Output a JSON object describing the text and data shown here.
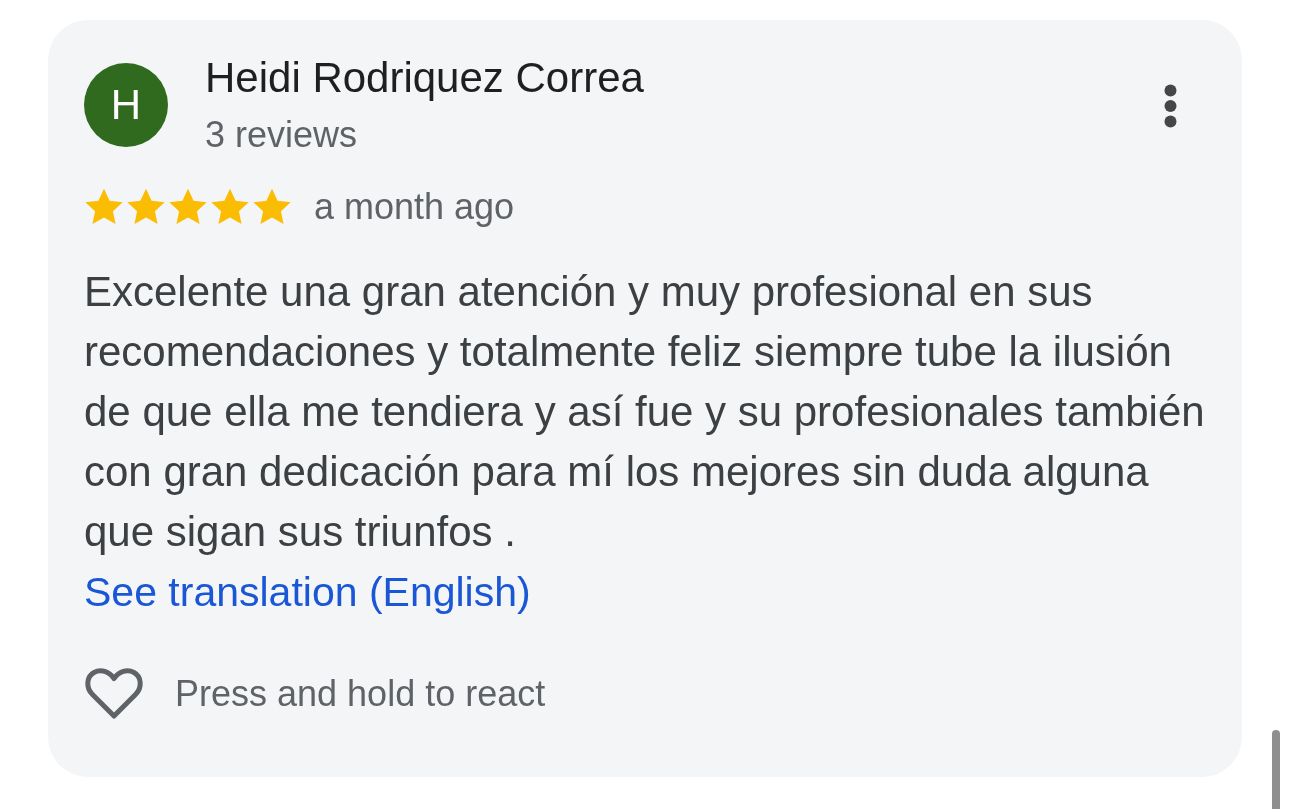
{
  "review": {
    "author": {
      "initial": "H",
      "name": "Heidi Rodriquez Correa",
      "reviews": "3 reviews"
    },
    "stars": 5,
    "time": "a month ago",
    "text": "Excelente una gran atención y muy profesional en sus recomendaciones y totalmente feliz siempre tube la ilusión de que ella me tendiera y así fue y su profesionales también con gran dedicación para mí los mejores sin duda alguna que sigan sus triunfos .",
    "translation_link": "See translation (English)",
    "reaction_hint": "Press and hold to react"
  }
}
